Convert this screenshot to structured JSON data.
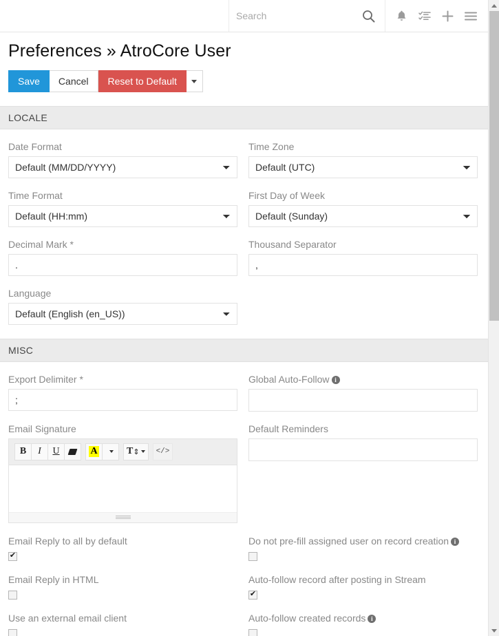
{
  "navbar": {
    "search": {
      "placeholder": "Search",
      "value": "",
      "icon": "search-icon"
    },
    "icons": [
      {
        "name": "bell-icon",
        "label": "Notifications"
      },
      {
        "name": "tasks-icon",
        "label": "Tasks"
      },
      {
        "name": "plus-icon",
        "label": "Create"
      },
      {
        "name": "hamburger-menu-icon",
        "label": "Menu"
      }
    ]
  },
  "page": {
    "title": "Preferences » AtroCore User"
  },
  "toolbar": {
    "save_label": "Save",
    "cancel_label": "Cancel",
    "reset_label": "Reset to Default",
    "dropdown_icon": "caret-down-icon"
  },
  "colors": {
    "primary": "#2196d9",
    "danger": "#d9534f",
    "panel_header_bg": "#ebebeb",
    "highlight": "#ffff00"
  },
  "panels": [
    {
      "id": "locale",
      "header": "LOCALE",
      "fields": [
        {
          "name": "date-format",
          "label": "Date Format",
          "type": "select",
          "value": "Default (MM/DD/YYYY)"
        },
        {
          "name": "time-zone",
          "label": "Time Zone",
          "type": "select",
          "value": "Default (UTC)"
        },
        {
          "name": "time-format",
          "label": "Time Format",
          "type": "select",
          "value": "Default (HH:mm)"
        },
        {
          "name": "first-day-of-week",
          "label": "First Day of Week",
          "type": "select",
          "value": "Default (Sunday)"
        },
        {
          "name": "decimal-mark",
          "label": "Decimal Mark *",
          "type": "text",
          "value": "."
        },
        {
          "name": "thousand-separator",
          "label": "Thousand Separator",
          "type": "text",
          "value": ","
        },
        {
          "name": "language",
          "label": "Language",
          "type": "select",
          "value": "Default (English (en_US))"
        }
      ]
    },
    {
      "id": "misc",
      "header": "MISC",
      "fields": [
        {
          "name": "export-delimiter",
          "label": "Export Delimiter *",
          "type": "text",
          "value": ";"
        },
        {
          "name": "global-auto-follow",
          "label": "Global Auto-Follow",
          "type": "text",
          "value": "",
          "info": true
        },
        {
          "name": "email-signature",
          "label": "Email Signature",
          "type": "wysiwyg",
          "value": ""
        },
        {
          "name": "default-reminders",
          "label": "Default Reminders",
          "type": "text",
          "value": ""
        }
      ],
      "checkboxes": [
        {
          "name": "email-reply-to-all-by-default",
          "label": "Email Reply to all by default",
          "checked": true,
          "info": false
        },
        {
          "name": "do-not-prefill-assigned-user",
          "label": "Do not pre-fill assigned user on record creation",
          "checked": false,
          "info": true
        },
        {
          "name": "email-reply-in-html",
          "label": "Email Reply in HTML",
          "checked": false,
          "info": false
        },
        {
          "name": "auto-follow-record-after-posting",
          "label": "Auto-follow record after posting in Stream",
          "checked": true,
          "info": false
        },
        {
          "name": "use-external-email-client",
          "label": "Use an external email client",
          "checked": false,
          "info": false
        },
        {
          "name": "auto-follow-created-records",
          "label": "Auto-follow created records",
          "checked": false,
          "info": true
        }
      ]
    }
  ],
  "editor_toolbar": {
    "buttons": [
      {
        "name": "bold-button",
        "label": "B"
      },
      {
        "name": "italic-button",
        "label": "I"
      },
      {
        "name": "underline-button",
        "label": "U"
      },
      {
        "name": "remove-format-button",
        "label": ""
      },
      {
        "name": "text-highlight-button",
        "label": "A"
      },
      {
        "name": "highlight-dropdown-button",
        "label": ""
      },
      {
        "name": "font-size-button",
        "label": "T"
      },
      {
        "name": "code-view-button",
        "label": "</>"
      }
    ]
  },
  "scrollbar": {
    "up_icon": "triangle-up-icon",
    "down_icon": "triangle-down-icon"
  }
}
